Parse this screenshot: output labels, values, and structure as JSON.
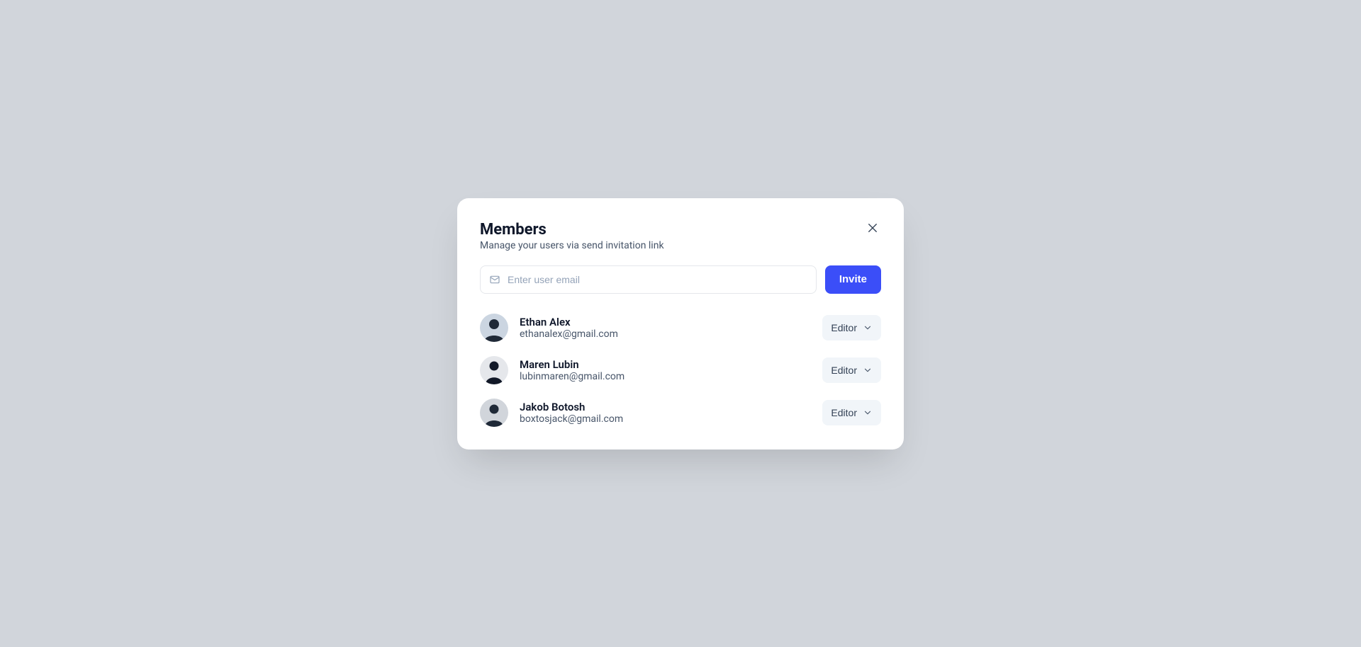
{
  "modal": {
    "title": "Members",
    "subtitle": "Manage your users via send invitation link"
  },
  "invite": {
    "placeholder": "Enter user email",
    "button_label": "Invite"
  },
  "members": [
    {
      "name": "Ethan Alex",
      "email": "ethanalex@gmail.com",
      "role": "Editor"
    },
    {
      "name": "Maren Lubin",
      "email": "lubinmaren@gmail.com",
      "role": "Editor"
    },
    {
      "name": "Jakob Botosh",
      "email": "boxtosjack@gmail.com",
      "role": "Editor"
    }
  ]
}
